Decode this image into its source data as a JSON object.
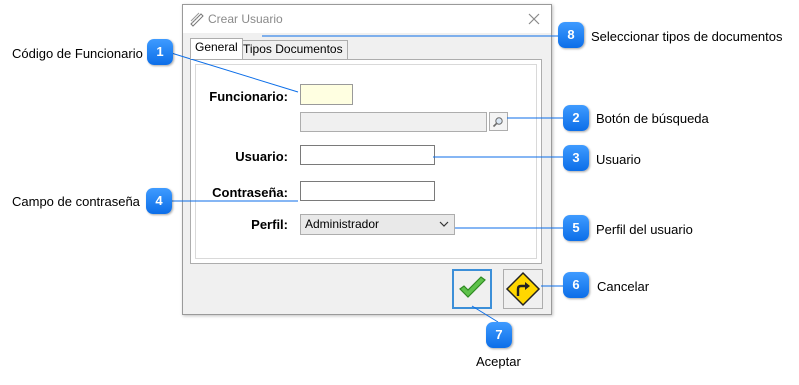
{
  "dialog": {
    "title": "Crear Usuario",
    "tabs": [
      {
        "label": "General"
      },
      {
        "label": "Tipos Documentos"
      }
    ],
    "fields": {
      "funcionario_label": "Funcionario:",
      "usuario_label": "Usuario:",
      "contrasena_label": "Contraseña:",
      "perfil_label": "Perfil:",
      "perfil_value": "Administrador"
    }
  },
  "callouts": [
    {
      "number": "1",
      "text": "Código de Funcionario"
    },
    {
      "number": "2",
      "text": "Botón de búsqueda"
    },
    {
      "number": "3",
      "text": "Usuario"
    },
    {
      "number": "4",
      "text": "Campo de contraseña"
    },
    {
      "number": "5",
      "text": "Perfil del usuario"
    },
    {
      "number": "6",
      "text": "Cancelar"
    },
    {
      "number": "7",
      "text": "Aceptar"
    },
    {
      "number": "8",
      "text": "Seleccionar tipos de documentos"
    }
  ],
  "icons": {
    "app": "pencil-ruler-icon",
    "close": "close-icon",
    "search": "magnifier-icon",
    "dropdown": "chevron-down-icon",
    "accept": "checkmark-icon",
    "cancel": "turn-right-sign-icon"
  },
  "colors": {
    "callout_blue": "#0c6ee8",
    "accept_green": "#4cb43c",
    "cancel_yellow": "#ffd700"
  }
}
